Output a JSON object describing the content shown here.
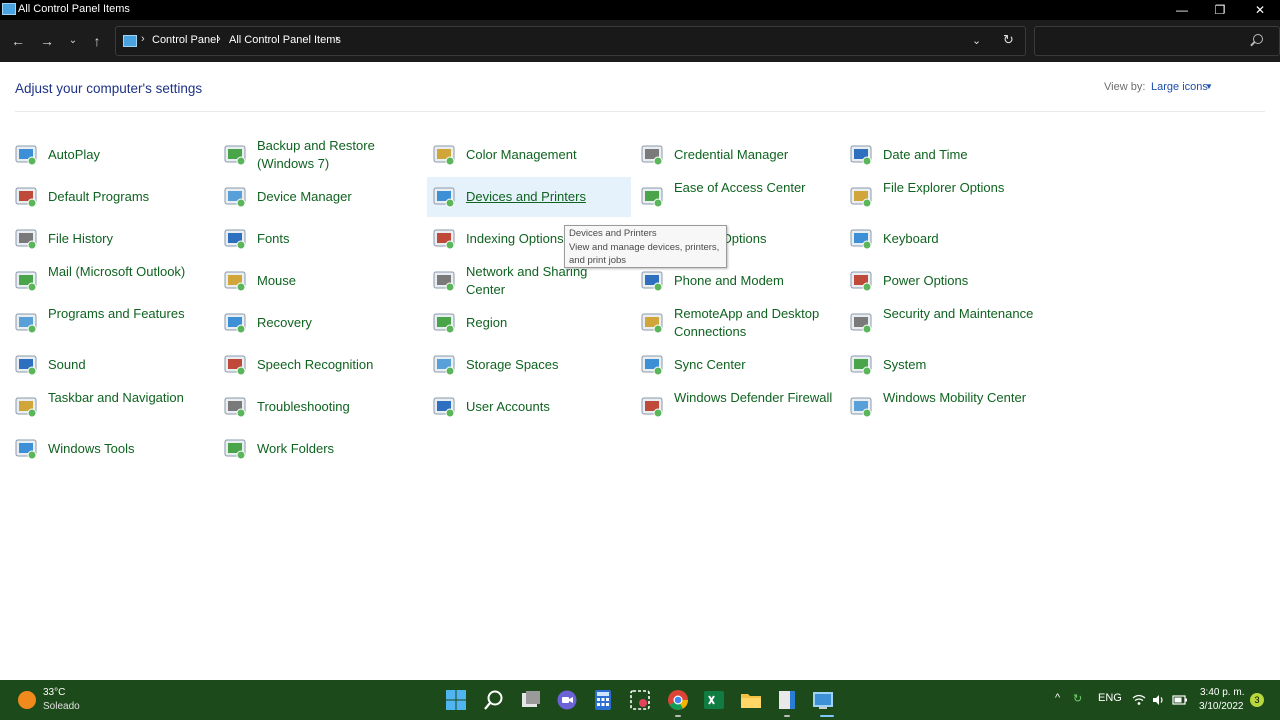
{
  "window": {
    "title": "All Control Panel Items"
  },
  "address": {
    "crumbs": [
      "Control Panel",
      "All Control Panel Items"
    ]
  },
  "search": {
    "placeholder": ""
  },
  "content": {
    "heading": "Adjust your computer's settings",
    "view_by_label": "View by:",
    "view_by_value": "Large icons"
  },
  "items": [
    {
      "label": "AutoPlay",
      "icon": "autoplay-icon"
    },
    {
      "label": "Backup and Restore (Windows 7)",
      "icon": "backup-restore-icon"
    },
    {
      "label": "Color Management",
      "icon": "color-management-icon"
    },
    {
      "label": "Credential Manager",
      "icon": "credential-manager-icon"
    },
    {
      "label": "Date and Time",
      "icon": "date-time-icon"
    },
    {
      "label": "Default Programs",
      "icon": "default-programs-icon"
    },
    {
      "label": "Device Manager",
      "icon": "device-manager-icon"
    },
    {
      "label": "Devices and Printers",
      "icon": "devices-printers-icon"
    },
    {
      "label": "Ease of Access Center",
      "icon": "ease-of-access-icon"
    },
    {
      "label": "File Explorer Options",
      "icon": "file-explorer-options-icon"
    },
    {
      "label": "File History",
      "icon": "file-history-icon"
    },
    {
      "label": "Fonts",
      "icon": "fonts-icon"
    },
    {
      "label": "Indexing Options",
      "icon": "indexing-options-icon"
    },
    {
      "label": "Internet Options",
      "icon": "internet-options-icon"
    },
    {
      "label": "Keyboard",
      "icon": "keyboard-icon"
    },
    {
      "label": "Mail (Microsoft Outlook)",
      "icon": "mail-icon"
    },
    {
      "label": "Mouse",
      "icon": "mouse-icon"
    },
    {
      "label": "Network and Sharing Center",
      "icon": "network-sharing-icon"
    },
    {
      "label": "Phone and Modem",
      "icon": "phone-modem-icon"
    },
    {
      "label": "Power Options",
      "icon": "power-options-icon"
    },
    {
      "label": "Programs and Features",
      "icon": "programs-features-icon"
    },
    {
      "label": "Recovery",
      "icon": "recovery-icon"
    },
    {
      "label": "Region",
      "icon": "region-icon"
    },
    {
      "label": "RemoteApp and Desktop Connections",
      "icon": "remoteapp-icon"
    },
    {
      "label": "Security and Maintenance",
      "icon": "security-maintenance-icon"
    },
    {
      "label": "Sound",
      "icon": "sound-icon"
    },
    {
      "label": "Speech Recognition",
      "icon": "speech-recognition-icon"
    },
    {
      "label": "Storage Spaces",
      "icon": "storage-spaces-icon"
    },
    {
      "label": "Sync Center",
      "icon": "sync-center-icon"
    },
    {
      "label": "System",
      "icon": "system-icon"
    },
    {
      "label": "Taskbar and Navigation",
      "icon": "taskbar-navigation-icon"
    },
    {
      "label": "Troubleshooting",
      "icon": "troubleshooting-icon"
    },
    {
      "label": "User Accounts",
      "icon": "user-accounts-icon"
    },
    {
      "label": "Windows Defender Firewall",
      "icon": "firewall-icon"
    },
    {
      "label": "Windows Mobility Center",
      "icon": "mobility-center-icon"
    },
    {
      "label": "Windows Tools",
      "icon": "windows-tools-icon"
    },
    {
      "label": "Work Folders",
      "icon": "work-folders-icon"
    }
  ],
  "tooltip": {
    "title": "Devices and Printers",
    "line1": "View and manage devices, printers,",
    "line2": "and print jobs"
  },
  "taskbar": {
    "temperature": "33°C",
    "weather": "Soleado",
    "language": "ENG",
    "time": "3:40 p. m.",
    "date": "3/10/2022",
    "notifications": "3"
  },
  "colors": {
    "link": "#0f6320",
    "heading": "#1e3287",
    "taskbar": "#1d4a1a",
    "hover": "#e5f1fb"
  }
}
